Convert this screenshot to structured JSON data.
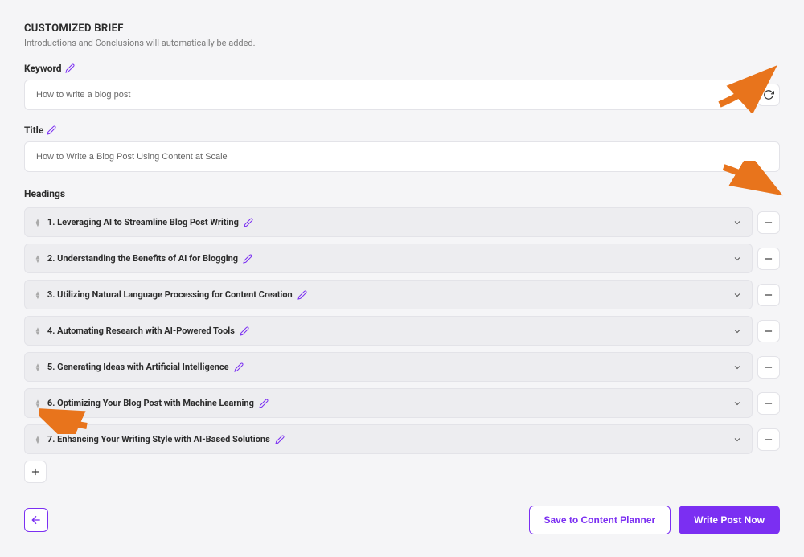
{
  "header": {
    "title": "CUSTOMIZED BRIEF",
    "subtitle": "Introductions and Conclusions will automatically be added."
  },
  "keyword": {
    "label": "Keyword",
    "value": "How to write a blog post"
  },
  "title_field": {
    "label": "Title",
    "value": "How to Write a Blog Post Using Content at Scale"
  },
  "headings": {
    "label": "Headings",
    "items": [
      {
        "text": "1. Leveraging AI to Streamline Blog Post Writing"
      },
      {
        "text": "2. Understanding the Benefits of AI for Blogging"
      },
      {
        "text": "3. Utilizing Natural Language Processing for Content Creation"
      },
      {
        "text": "4. Automating Research with AI-Powered Tools"
      },
      {
        "text": "5. Generating Ideas with Artificial Intelligence"
      },
      {
        "text": "6. Optimizing Your Blog Post with Machine Learning"
      },
      {
        "text": "7. Enhancing Your Writing Style with AI-Based Solutions"
      }
    ]
  },
  "footer": {
    "save_label": "Save to Content Planner",
    "write_label": "Write Post Now"
  }
}
